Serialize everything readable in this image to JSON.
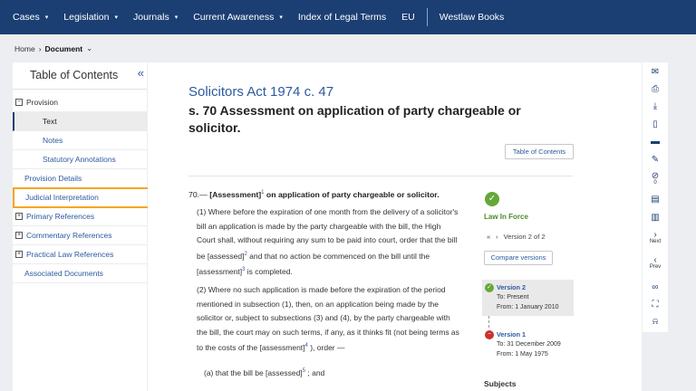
{
  "nav": {
    "items": [
      {
        "label": "Cases",
        "caret": "▾"
      },
      {
        "label": "Legislation",
        "caret": "▾"
      },
      {
        "label": "Journals",
        "caret": "▾"
      },
      {
        "label": "Current Awareness",
        "caret": "▾"
      },
      {
        "label": "Index of Legal Terms",
        "caret": ""
      },
      {
        "label": "EU",
        "caret": ""
      }
    ],
    "westlaw_books": "Westlaw Books"
  },
  "breadcrumb": {
    "home": "Home",
    "sep": "›",
    "current": "Document",
    "caret": "⌄"
  },
  "toc": {
    "title": "Table of Contents",
    "collapse": "«",
    "provision": "Provision",
    "provision_box": "−",
    "text": "Text",
    "notes": "Notes",
    "statutory": "Statutory Annotations",
    "provision_details": "Provision Details",
    "judicial": "Judicial Interpretation",
    "primary": "Primary References",
    "commentary": "Commentary References",
    "practical": "Practical Law References",
    "associated": "Associated Documents",
    "plus": "+"
  },
  "doc": {
    "title": "Solicitors Act 1974 c. 47",
    "heading": "s. 70 Assessment on application of party chargeable or solicitor.",
    "toc_button": "Table of Contents",
    "section": {
      "number": "70.—",
      "text1": "[Assessment]",
      "sup1": "1",
      "text2": " on application of party chargeable or solicitor."
    },
    "para1": {
      "a": "(1)  Where before the expiration of one month from the delivery of a solicitor's bill an application is made by the party chargeable with the bill, the High Court shall, without requiring any sum to be paid into court, order that the bill be [assessed]",
      "sup_a": "2",
      "b": " and that no action be commenced on the bill until the [assessment]",
      "sup_b": "3",
      "c": " is completed."
    },
    "para2": {
      "a": "(2)  Where no such application is made before the expiration of the period mentioned in subsection (1), then, on an application being made by the solicitor or, subject to subsections (3) and (4), by the party chargeable with the bill, the court may on such terms, if any, as it thinks fit (not being terms as to the costs of the [assessment]",
      "sup_a": "4",
      "b": " ), order —"
    },
    "para3": {
      "a": "(a)  that the bill be [assessed]",
      "sup_a": "5",
      "b": " ; and"
    }
  },
  "status": {
    "check": "✓",
    "label": "Law In Force",
    "first": "«",
    "prev": "‹",
    "version_of": "Version 2 of 2",
    "compare": "Compare versions",
    "v2": {
      "name": "Version 2",
      "to": "To: Present",
      "from": "From: 1 January 2010",
      "icon": "✓"
    },
    "v1": {
      "name": "Version 1",
      "to": "To: 31 December 2009",
      "from": "From: 1 May 1975",
      "icon": "−"
    },
    "subjects": "Subjects"
  },
  "toolbar": {
    "email": "✉",
    "print": "⎙",
    "download": "⤓",
    "mobile": "▯",
    "folder": "▬",
    "annotate": "✎",
    "hide": "⊘",
    "hide_count": "0",
    "book": "▤",
    "doc": "▥",
    "next": "›",
    "next_label": "Next",
    "prev": "‹",
    "prev_label": "Prev",
    "link": "∞",
    "expand": "⛶",
    "bell": "⍾"
  }
}
